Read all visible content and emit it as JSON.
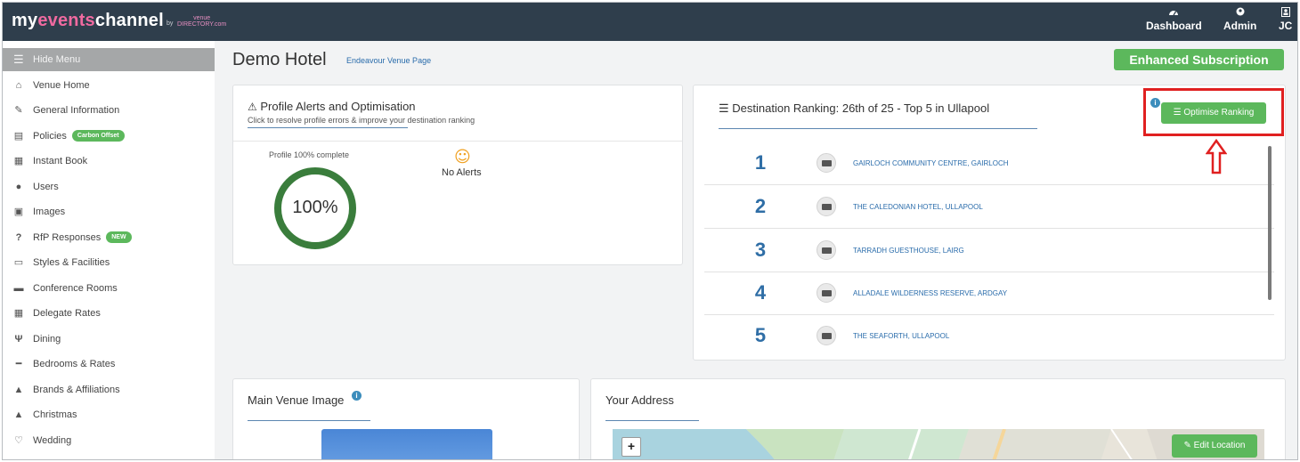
{
  "topbar": {
    "logo": {
      "prefix": "my",
      "accent": "events",
      "suffix": "channel",
      "by": "by",
      "venue": "venue",
      "directory": "DIRECTORY.com"
    },
    "nav": [
      {
        "label": "Dashboard",
        "icon": "dashboard-icon"
      },
      {
        "label": "Admin",
        "icon": "admin-icon"
      },
      {
        "label": "JC",
        "icon": "user-icon"
      }
    ]
  },
  "sidebar": {
    "hide_menu": "Hide Menu",
    "items": [
      {
        "label": "Venue Home",
        "icon": "home-icon"
      },
      {
        "label": "General Information",
        "icon": "edit-icon"
      },
      {
        "label": "Policies",
        "icon": "document-icon",
        "badge": "Carbon Offset"
      },
      {
        "label": "Instant Book",
        "icon": "calendar-icon"
      },
      {
        "label": "Users",
        "icon": "user-icon"
      },
      {
        "label": "Images",
        "icon": "image-icon"
      },
      {
        "label": "RfP Responses",
        "icon": "question-icon",
        "badge": "NEW"
      },
      {
        "label": "Styles & Facilities",
        "icon": "monitor-icon"
      },
      {
        "label": "Conference Rooms",
        "icon": "briefcase-icon"
      },
      {
        "label": "Delegate Rates",
        "icon": "calculator-icon"
      },
      {
        "label": "Dining",
        "icon": "cutlery-icon"
      },
      {
        "label": "Bedrooms & Rates",
        "icon": "bed-icon"
      },
      {
        "label": "Brands & Affiliations",
        "icon": "book-icon"
      },
      {
        "label": "Christmas",
        "icon": "tree-icon"
      },
      {
        "label": "Wedding",
        "icon": "heart-icon"
      }
    ]
  },
  "main": {
    "title": "Demo Hotel",
    "venue_link": "Endeavour Venue Page",
    "subscription": "Enhanced Subscription"
  },
  "alerts": {
    "title": "Profile Alerts and Optimisation",
    "subtitle": "Click to resolve profile errors & improve your destination ranking",
    "profile_label": "Profile 100% complete",
    "progress": "100%",
    "no_alerts": "No Alerts"
  },
  "ranking": {
    "title": "Destination Ranking: 26th of 25 - Top 5 in Ullapool",
    "optimise_label": "Optimise Ranking",
    "rows": [
      {
        "rank": "1",
        "name": "GAIRLOCH COMMUNITY CENTRE, GAIRLOCH"
      },
      {
        "rank": "2",
        "name": "THE CALEDONIAN HOTEL, ULLAPOOL"
      },
      {
        "rank": "3",
        "name": "TARRADH GUESTHOUSE, LAIRG"
      },
      {
        "rank": "4",
        "name": "ALLADALE WILDERNESS RESERVE, ARDGAY"
      },
      {
        "rank": "5",
        "name": "THE SEAFORTH, ULLAPOOL"
      }
    ]
  },
  "main_image": {
    "title": "Main Venue Image"
  },
  "address": {
    "title": "Your Address",
    "zoom_in": "+",
    "edit_location": "Edit Location"
  },
  "colors": {
    "accent_green": "#5cb85c",
    "link_blue": "#2a6cab",
    "topbar": "#2f3e4c",
    "highlight_red": "#e02020"
  }
}
